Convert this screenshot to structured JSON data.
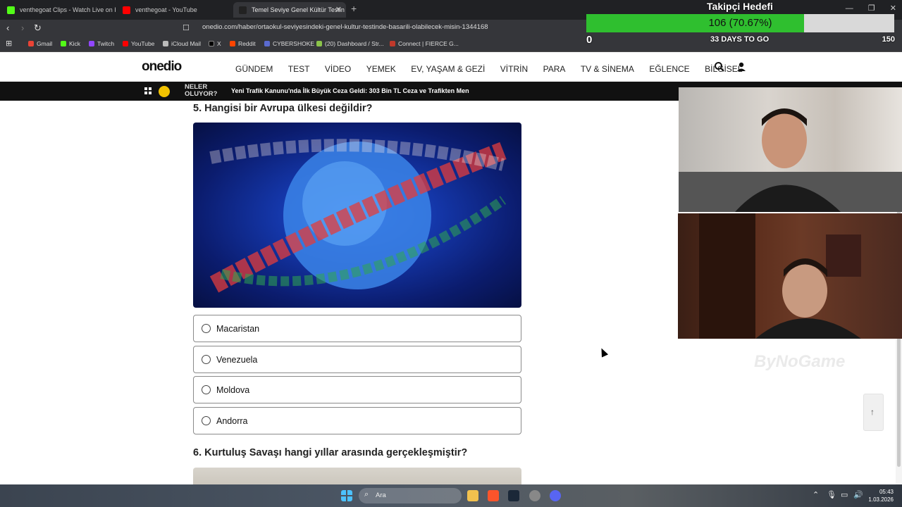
{
  "browser": {
    "tabs": [
      {
        "label": "venthegoat Clips - Watch Live on Kick",
        "icon_color": "#53fc18"
      },
      {
        "label": "venthegoat - YouTube",
        "icon_color": "#ff0000"
      },
      {
        "label": "Temel Seviye Genel Kültür Testin",
        "icon_color": "#222222"
      }
    ],
    "url": "onedio.com/haber/ortaokul-seviyesindeki-genel-kultur-testinde-basarili-olabilecek-misin-1344168",
    "bookmarks": [
      "Gmail",
      "Kick",
      "Twitch",
      "YouTube",
      "iCloud Mail",
      "X",
      "Reddit",
      "CYBERSHOKE",
      "(20) Dashboard / Str...",
      "Connect | FIERCE G..."
    ]
  },
  "goal": {
    "title": "Takipçi Hedefi",
    "current_text": "106 (70.67%)",
    "progress": 0.7067,
    "min": "0",
    "days": "33 DAYS TO GO",
    "max": "150"
  },
  "site": {
    "logo": "onedio",
    "nav": [
      "GÜNDEM",
      "TEST",
      "VİDEO",
      "YEMEK",
      "EV, YAŞAM & GEZİ",
      "VİTRİN",
      "PARA",
      "TV & SİNEMA",
      "EĞLENCE",
      "BİLGİSEL"
    ],
    "ticker_label": "NELER OLUYOR?",
    "ticker_news": "Yeni Trafik Kanunu'nda İlk Büyük Ceza Geldi: 303 Bin TL Ceza ve Trafikten Men"
  },
  "quiz": {
    "q5_title": "5. Hangisi bir Avrupa ülkesi değildir?",
    "options": [
      "Macaristan",
      "Venezuela",
      "Moldova",
      "Andorra"
    ],
    "q6_title": "6. Kurtuluş Savaşı hangi yıllar arasında gerçekleşmiştir?"
  },
  "overlay": {
    "watermark": "ByNoGame"
  },
  "taskbar": {
    "search_placeholder": "Ara",
    "time": "05:43",
    "date": "1.03.2026"
  }
}
